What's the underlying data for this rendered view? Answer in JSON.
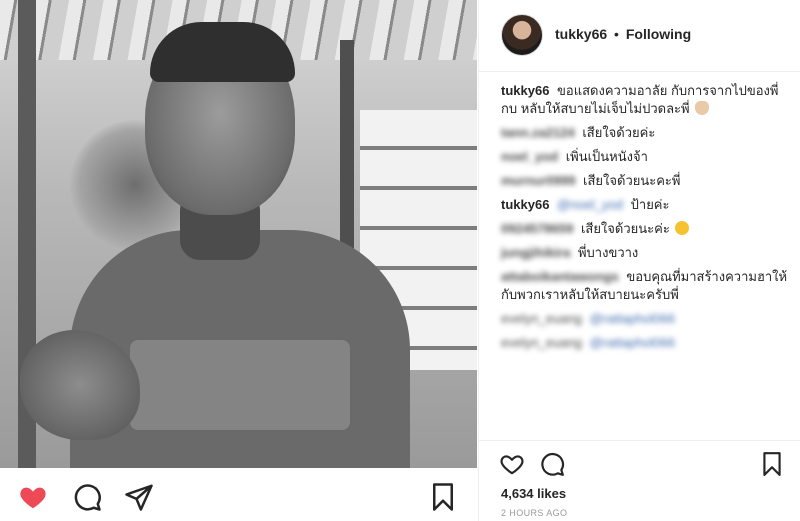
{
  "post": {
    "username": "tukky66",
    "separator": "•",
    "follow_status": "Following",
    "likes": "4,634 likes",
    "timestamp": "2 HOURS AGO"
  },
  "comments": [
    {
      "user": "tukky66",
      "user_blurred": false,
      "text": "ขอแสดงความอาลัย กับการจากไปของพี่กบ หลับให้สบายไม่เจ็บไม่ปวดละพี่",
      "emoji": "pray"
    },
    {
      "user": "tann.za2124",
      "user_blurred": true,
      "text": "เสียใจด้วยค่ะ"
    },
    {
      "user": "noel_yod",
      "user_blurred": true,
      "text": "เพิ่นเป็นหนังจ้า"
    },
    {
      "user": "murnur0999",
      "user_blurred": true,
      "text": "เสียใจด้วยนะคะพี่"
    },
    {
      "user": "tukky66",
      "user_blurred": false,
      "mention": "@noel_yod",
      "text": "ป้ายค่ะ"
    },
    {
      "user": "0924578659",
      "user_blurred": true,
      "text": "เสียใจด้วยนะค่ะ",
      "emoji": "cry"
    },
    {
      "user": "jungjihikira",
      "user_blurred": true,
      "text": "พี่บางขวาง"
    },
    {
      "user": "attaboikantawongs",
      "user_blurred": true,
      "text": "ขอบคุณที่มาสร้างความฮาให้กับพวกเราหลับให้สบายนะครับพี่"
    },
    {
      "user": "evelyn_euang",
      "user_blurred": true,
      "mention": "@rattaphol066",
      "text": ""
    },
    {
      "user": "evelyn_euang",
      "user_blurred": true,
      "mention": "@rattaphol066",
      "text": ""
    }
  ],
  "icons": {
    "heart_filled_color": "#ed4956",
    "icon_color": "#262626"
  }
}
